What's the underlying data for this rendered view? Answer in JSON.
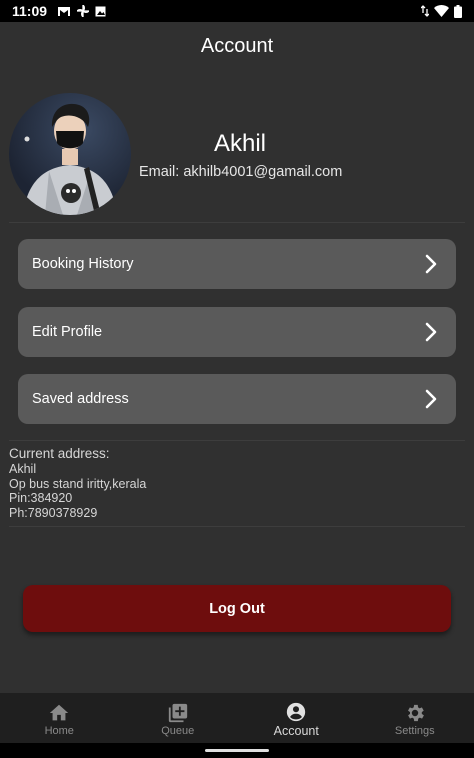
{
  "status_bar": {
    "time": "11:09",
    "left_icons": [
      "gmail-icon",
      "pinwheel-icon",
      "image-icon"
    ],
    "right_icons": [
      "data-transfer-icon",
      "wifi-icon",
      "battery-icon"
    ]
  },
  "app_bar": {
    "title": "Account"
  },
  "profile": {
    "name": "Akhil",
    "email": "Email: akhilb4001@gamail.com"
  },
  "menu": [
    {
      "label": "Booking History",
      "icon": "chevron-right-icon"
    },
    {
      "label": "Edit Profile",
      "icon": "chevron-right-icon"
    },
    {
      "label": "Saved address",
      "icon": "chevron-right-icon"
    }
  ],
  "address": {
    "title": "Current address:",
    "lines": [
      "Akhil",
      "Op bus stand iritty,kerala",
      "Pin:384920",
      "Ph:7890378929"
    ]
  },
  "logout": {
    "label": "Log Out"
  },
  "bottom_nav": [
    {
      "label": "Home",
      "icon": "home-icon",
      "active": false
    },
    {
      "label": "Queue",
      "icon": "queue-add-icon",
      "active": false
    },
    {
      "label": "Account",
      "icon": "account-icon",
      "active": true
    },
    {
      "label": "Settings",
      "icon": "gear-icon",
      "active": false
    }
  ],
  "colors": {
    "background": "#303030",
    "card": "#5a5a5a",
    "logout": "#6e0d0d",
    "nav_background": "#1f1f1f"
  }
}
